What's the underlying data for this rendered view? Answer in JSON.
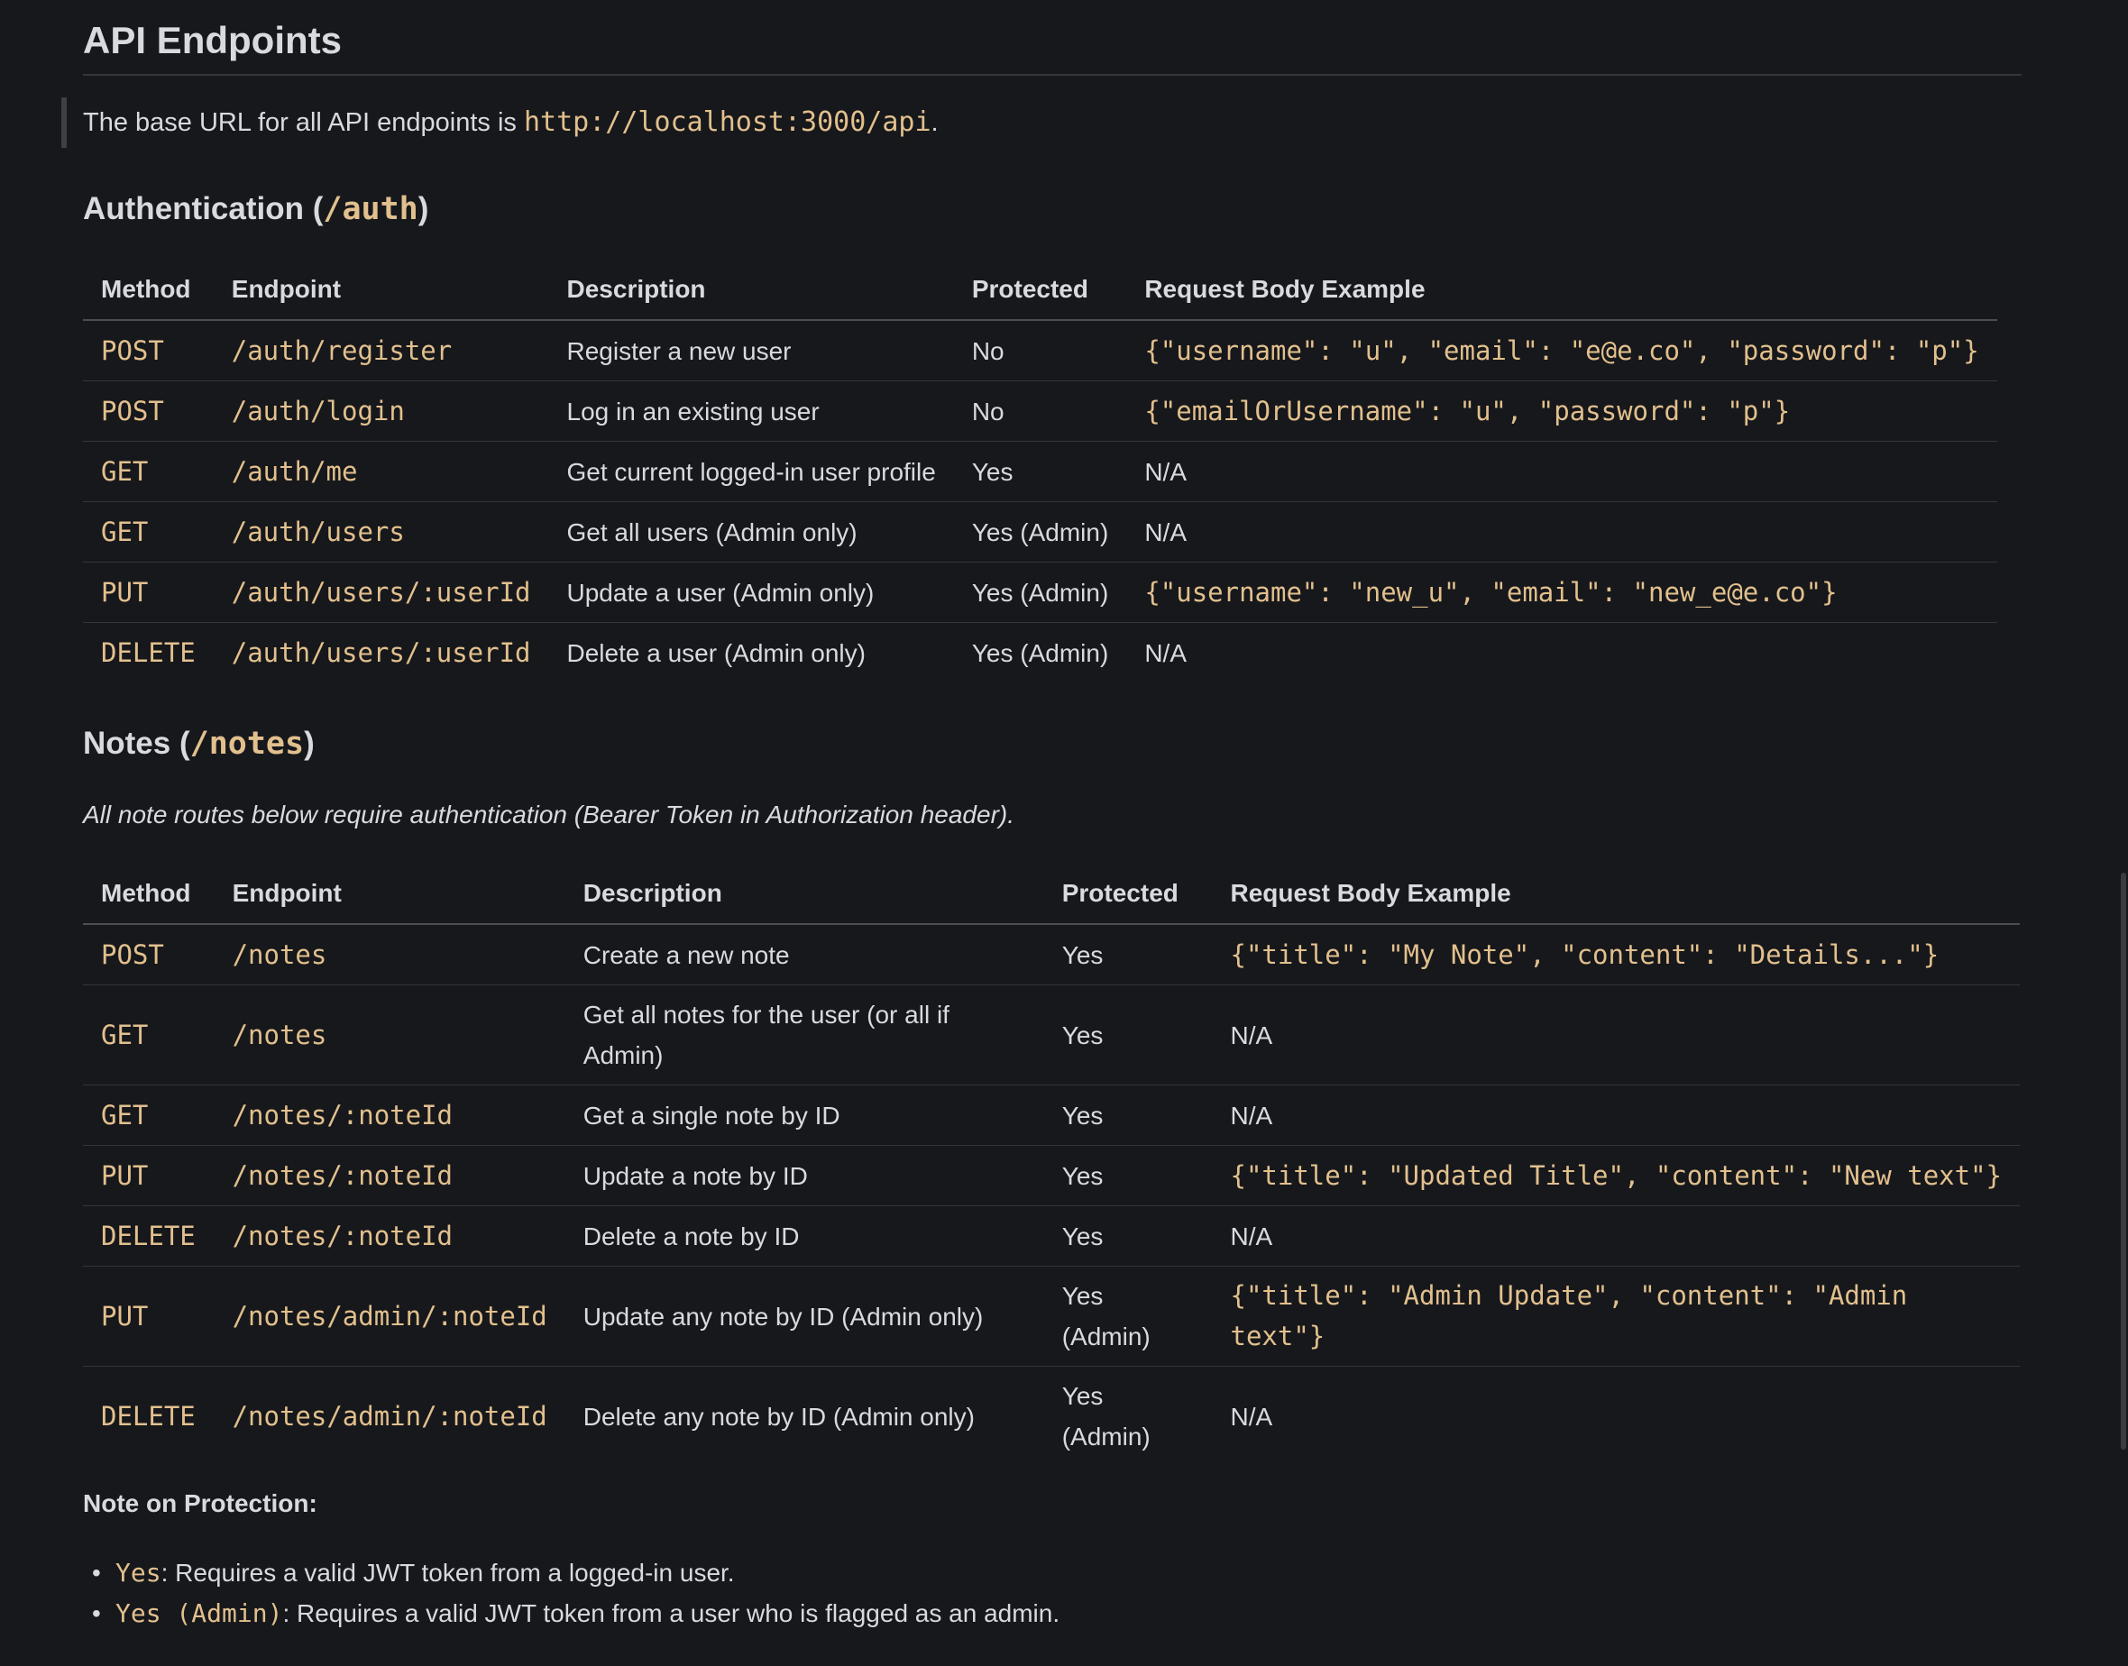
{
  "page": {
    "title": "API Endpoints",
    "base_url_prefix": "The base URL for all API endpoints is ",
    "base_url": "http://localhost:3000/api",
    "base_url_suffix": "."
  },
  "auth": {
    "heading_prefix": "Authentication (",
    "heading_code": "/auth",
    "heading_suffix": ")",
    "columns": [
      "Method",
      "Endpoint",
      "Description",
      "Protected",
      "Request Body Example"
    ],
    "rows": [
      {
        "method": "POST",
        "endpoint": "/auth/register",
        "description": "Register a new user",
        "protected": "No",
        "body": "{\"username\": \"u\", \"email\": \"e@e.co\", \"password\": \"p\"}",
        "body_is_code": true
      },
      {
        "method": "POST",
        "endpoint": "/auth/login",
        "description": "Log in an existing user",
        "protected": "No",
        "body": "{\"emailOrUsername\": \"u\", \"password\": \"p\"}",
        "body_is_code": true
      },
      {
        "method": "GET",
        "endpoint": "/auth/me",
        "description": "Get current logged-in user profile",
        "protected": "Yes",
        "body": "N/A",
        "body_is_code": false
      },
      {
        "method": "GET",
        "endpoint": "/auth/users",
        "description": "Get all users (Admin only)",
        "protected": "Yes (Admin)",
        "body": "N/A",
        "body_is_code": false
      },
      {
        "method": "PUT",
        "endpoint": "/auth/users/:userId",
        "description": "Update a user (Admin only)",
        "protected": "Yes (Admin)",
        "body": "{\"username\": \"new_u\", \"email\": \"new_e@e.co\"}",
        "body_is_code": true
      },
      {
        "method": "DELETE",
        "endpoint": "/auth/users/:userId",
        "description": "Delete a user (Admin only)",
        "protected": "Yes (Admin)",
        "body": "N/A",
        "body_is_code": false
      }
    ]
  },
  "notes": {
    "heading_prefix": "Notes (",
    "heading_code": "/notes",
    "heading_suffix": ")",
    "intro": "All note routes below require authentication (Bearer Token in Authorization header).",
    "columns": [
      "Method",
      "Endpoint",
      "Description",
      "Protected",
      "Request Body Example"
    ],
    "rows": [
      {
        "method": "POST",
        "endpoint": "/notes",
        "description": "Create a new note",
        "protected": "Yes",
        "body": "{\"title\": \"My Note\", \"content\": \"Details...\"}",
        "body_is_code": true
      },
      {
        "method": "GET",
        "endpoint": "/notes",
        "description": "Get all notes for the user (or all if Admin)",
        "protected": "Yes",
        "body": "N/A",
        "body_is_code": false
      },
      {
        "method": "GET",
        "endpoint": "/notes/:noteId",
        "description": "Get a single note by ID",
        "protected": "Yes",
        "body": "N/A",
        "body_is_code": false
      },
      {
        "method": "PUT",
        "endpoint": "/notes/:noteId",
        "description": "Update a note by ID",
        "protected": "Yes",
        "body": "{\"title\": \"Updated Title\", \"content\": \"New text\"}",
        "body_is_code": true
      },
      {
        "method": "DELETE",
        "endpoint": "/notes/:noteId",
        "description": "Delete a note by ID",
        "protected": "Yes",
        "body": "N/A",
        "body_is_code": false
      },
      {
        "method": "PUT",
        "endpoint": "/notes/admin/:noteId",
        "description": "Update any note by ID (Admin only)",
        "protected": "Yes (Admin)",
        "body": "{\"title\": \"Admin Update\", \"content\": \"Admin text\"}",
        "body_is_code": true
      },
      {
        "method": "DELETE",
        "endpoint": "/notes/admin/:noteId",
        "description": "Delete any note by ID (Admin only)",
        "protected": "Yes (Admin)",
        "body": "N/A",
        "body_is_code": false
      }
    ]
  },
  "protection_note": {
    "heading": "Note on Protection:",
    "items": [
      {
        "code": "Yes",
        "text": ": Requires a valid JWT token from a logged-in user."
      },
      {
        "code": "Yes (Admin)",
        "text": ": Requires a valid JWT token from a user who is flagged as an admin."
      }
    ]
  },
  "colors": {
    "background": "#17181c",
    "text": "#d9dadd",
    "code": "#e2c08d",
    "border": "#33363c"
  }
}
